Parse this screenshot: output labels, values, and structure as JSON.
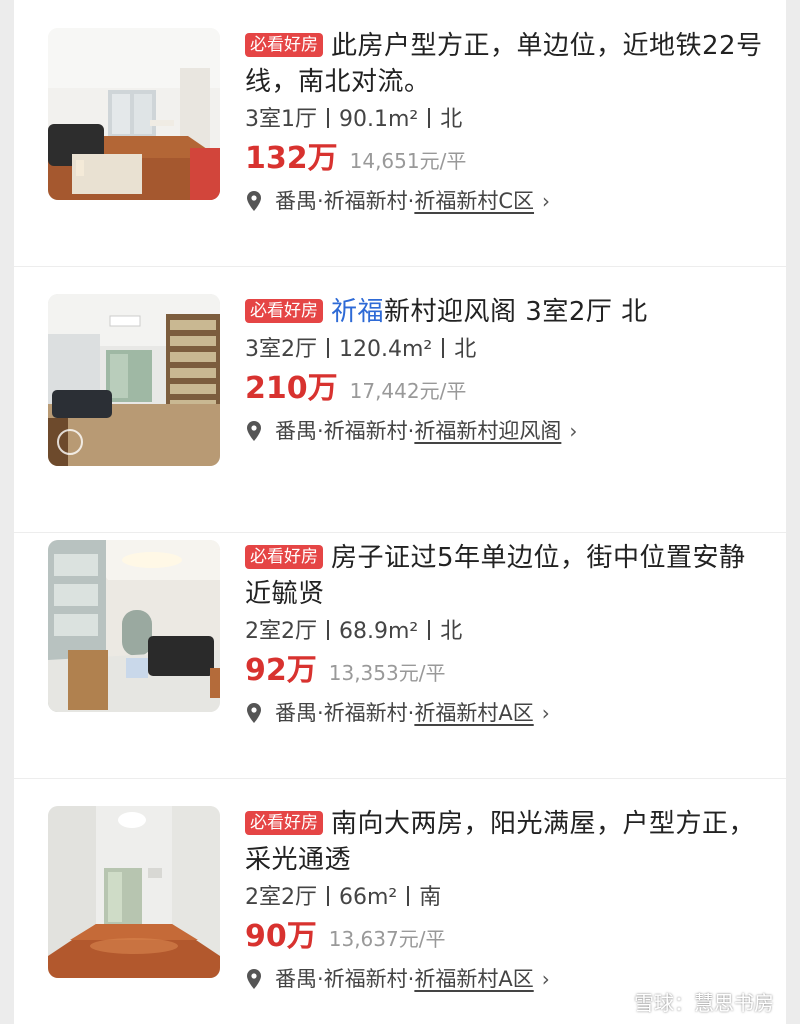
{
  "badge_label": "必看好房",
  "listings": [
    {
      "title_hl": "",
      "title": "此房户型方正，单边位，近地铁22号线，南北对流。",
      "layout": "3室1厅",
      "area": "90.1m²",
      "orientation": "北",
      "price": "132万",
      "unit_price": "14,651元/平",
      "district": "番禺·祈福新村·",
      "community": "祈福新村C区"
    },
    {
      "title_hl": "祈福",
      "title": "新村迎风阁 3室2厅 北",
      "layout": "3室2厅",
      "area": "120.4m²",
      "orientation": "北",
      "price": "210万",
      "unit_price": "17,442元/平",
      "district": "番禺·祈福新村·",
      "community": "祈福新村迎风阁"
    },
    {
      "title_hl": "",
      "title": "房子证过5年单边位，街中位置安静近毓贤",
      "layout": "2室2厅",
      "area": "68.9m²",
      "orientation": "北",
      "price": "92万",
      "unit_price": "13,353元/平",
      "district": "番禺·祈福新村·",
      "community": "祈福新村A区"
    },
    {
      "title_hl": "",
      "title": "南向大两房，阳光满屋，户型方正，采光通透",
      "layout": "2室2厅",
      "area": "66m²",
      "orientation": "南",
      "price": "90万",
      "unit_price": "13,637元/平",
      "district": "番禺·祈福新村·",
      "community": "祈福新村A区"
    }
  ],
  "watermark": "雪球：慧思书房",
  "colors": {
    "badge": "#e54545",
    "price": "#d8322f",
    "highlight": "#2e6ad6"
  },
  "icons": {
    "location": "location-pin-icon",
    "chevron": "chevron-right-icon"
  }
}
